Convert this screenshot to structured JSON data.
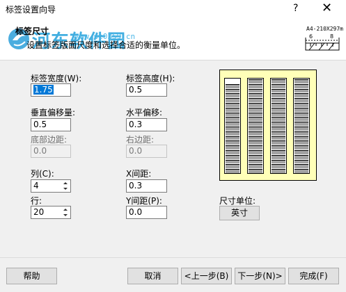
{
  "window": {
    "title": "标签设置向导",
    "help_glyph": "?",
    "close_glyph": "✕"
  },
  "header": {
    "watermark_site": "河东软件园",
    "watermark_url": "www.pc0359.cn",
    "step_title": "标签尺寸",
    "step_description": "设置标签版面尺度和选择合适的衡量单位。",
    "paper_label": "A4-210X297m",
    "ruler_numbers": [
      "6",
      "8"
    ]
  },
  "form": {
    "label_width": {
      "label": "标签宽度(W):",
      "value": "1.75"
    },
    "label_height": {
      "label": "标签高度(H):",
      "value": "0.5"
    },
    "vertical_offset": {
      "label": "垂直偏移量:",
      "value": "0.5"
    },
    "horizontal_offset": {
      "label": "水平偏移:",
      "value": "0.3"
    },
    "bottom_margin": {
      "label": "底部边距:",
      "value": "0.0"
    },
    "right_margin": {
      "label": "右边距:",
      "value": "0.0"
    },
    "columns": {
      "label": "列(C):",
      "value": "4"
    },
    "x_spacing": {
      "label": "X间距:",
      "value": "0.3"
    },
    "rows": {
      "label": "行:",
      "value": "20"
    },
    "y_spacing": {
      "label": "Y间距(P):",
      "value": "0.0"
    }
  },
  "unit": {
    "label": "尺寸单位:",
    "button": "英寸"
  },
  "preview": {
    "columns": 4,
    "rows": 20,
    "highlight_color": "#ffffb8",
    "cell_color": "#a3a3a3"
  },
  "footer": {
    "help": "帮助",
    "cancel": "取消",
    "back": "<上一步(B)",
    "next": "下一步(N)>",
    "finish": "完成(F)"
  }
}
